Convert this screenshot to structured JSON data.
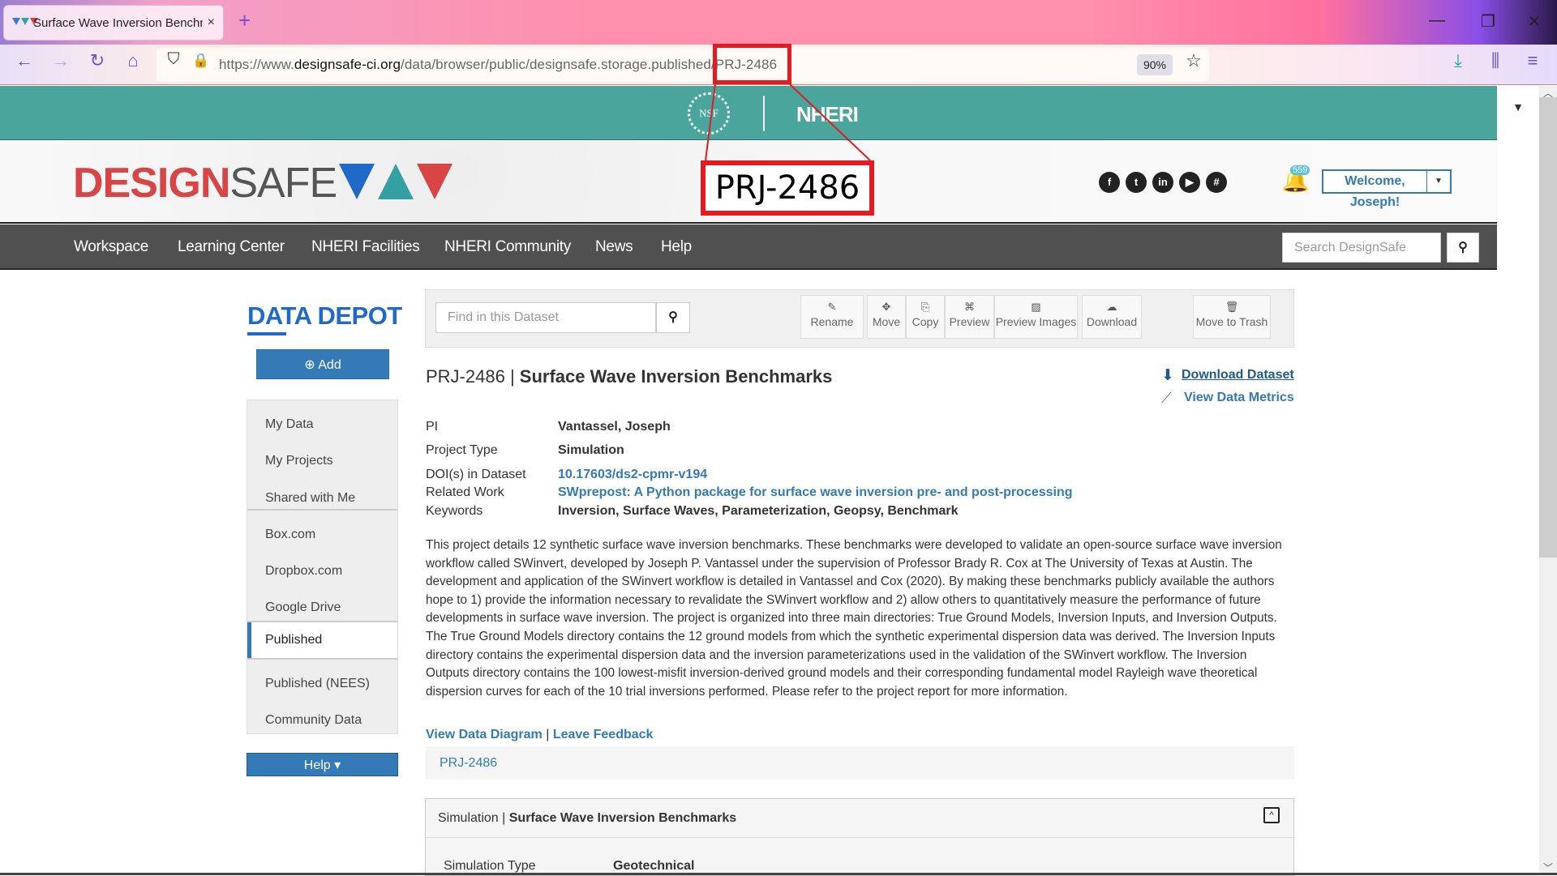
{
  "browser": {
    "tab_title": "Surface Wave Inversion Benchm",
    "tab_close": "×",
    "new_tab": "+",
    "url_prefix": "https://www.",
    "url_domain": "designsafe-ci.org",
    "url_path": "/data/browser/public/designsafe.storage.published/PRJ-2486",
    "zoom": "90%",
    "window_controls": {
      "minimize": "—",
      "restore": "❐",
      "close": "✕"
    },
    "nav_icons": {
      "back": "←",
      "forward": "→",
      "reload": "↻",
      "home": "⌂",
      "shield": "⛉",
      "lock": "🔒",
      "star": "☆",
      "download": "⤓",
      "library": "⫼",
      "menu": "≡"
    }
  },
  "annotation": {
    "highlight_text": "PRJ-2486",
    "color": "#e41b23"
  },
  "banner": {
    "nsf": "NSF",
    "nheri": "NHERI",
    "dropdown": "▼"
  },
  "header": {
    "logo_bold": "DESIGN",
    "logo_light": "SAFE",
    "social": [
      "f",
      "t",
      "in",
      "▶",
      "#"
    ],
    "notification_count": "559",
    "bell": "🔔",
    "welcome": "Welcome, Joseph!",
    "welcome_caret": "▼"
  },
  "nav": {
    "items": [
      "Workspace",
      "Learning Center",
      "NHERI Facilities",
      "NHERI Community",
      "News",
      "Help"
    ],
    "search_placeholder": "Search DesignSafe",
    "search_icon": "⚲"
  },
  "sidebar": {
    "title": "DATA DEPOT",
    "add_label": "⊕ Add",
    "items": [
      "My Data",
      "My Projects",
      "Shared with Me",
      "Box.com",
      "Dropbox.com",
      "Google Drive",
      "Published",
      "Published (NEES)",
      "Community Data"
    ],
    "active": "Published",
    "help_label": "Help ▾"
  },
  "toolbar": {
    "find_placeholder": "Find in this Dataset",
    "find_icon": "⚲",
    "buttons": [
      {
        "icon": "✎",
        "label": "Rename"
      },
      {
        "icon": "✥",
        "label": "Move"
      },
      {
        "icon": "⎘",
        "label": "Copy"
      },
      {
        "icon": "⌘",
        "label": "Preview"
      },
      {
        "icon": "▨",
        "label": "Preview Images"
      },
      {
        "icon": "☁",
        "label": "Download"
      },
      {
        "icon": "🗑",
        "label": "Move to Trash"
      }
    ]
  },
  "project": {
    "id": "PRJ-2486",
    "separator": " | ",
    "title": "Surface Wave Inversion Benchmarks",
    "download_dataset": "Download Dataset",
    "download_icon": "⬇",
    "view_metrics": "View Data Metrics",
    "metrics_icon": "⟋",
    "metadata": [
      {
        "label": "PI",
        "value": "Vantassel, Joseph",
        "link": false
      },
      {
        "label": "Project Type",
        "value": "Simulation",
        "link": false
      },
      {
        "label": "DOI(s) in Dataset",
        "value": "10.17603/ds2-cpmr-v194",
        "link": true
      },
      {
        "label": "Related Work",
        "value": "SWprepost: A Python package for surface wave inversion pre- and post-processing",
        "link": true
      },
      {
        "label": "Keywords",
        "value": "Inversion, Surface Waves, Parameterization, Geopsy, Benchmark",
        "link": false
      }
    ],
    "description": "This project details 12 synthetic surface wave inversion benchmarks. These benchmarks were developed to validate an open-source surface wave inversion workflow called SWinvert, developed by Joseph P. Vantassel under the supervision of Professor Brady R. Cox at The University of Texas at Austin. The development and application of the SWinvert workflow is detailed in Vantassel and Cox (2020). By making these benchmarks publicly available the authors hope to 1) provide the information necessary to revalidate the SWinvert workflow and 2) allow others to quantitatively measure the performance of future developments in surface wave inversion. The project is organized into three main directories: True Ground Models, Inversion Inputs, and Inversion Outputs. The True Ground Models directory contains the 12 ground models from which the synthetic experimental dispersion data was derived. The Inversion Inputs directory contains the experimental dispersion data and the inversion parameterizations used in the validation of the SWinvert workflow. The Inversion Outputs directory contains the 100 lowest-misfit inversion-derived ground models and their corresponding fundamental model Rayleigh wave theoretical dispersion curves for each of the 10 trial inversions performed. Please refer to the project report for more information.",
    "view_diagram": "View Data Diagram",
    "link_sep": " | ",
    "leave_feedback": "Leave Feedback",
    "breadcrumb": "PRJ-2486"
  },
  "simulation_panel": {
    "prefix": "Simulation",
    "sep": " | ",
    "title": "Surface Wave Inversion Benchmarks",
    "toggle": "^",
    "type_label": "Simulation Type",
    "type_value": "Geotechnical"
  }
}
